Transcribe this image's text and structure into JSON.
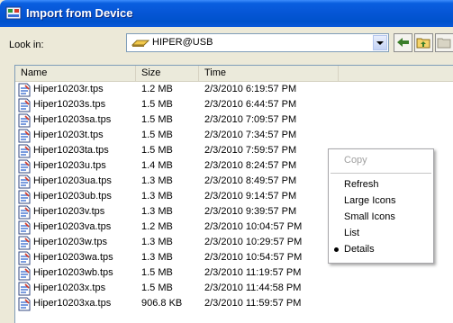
{
  "window": {
    "title": "Import from Device"
  },
  "toolbar": {
    "look_in_label": "Look in:",
    "location": "HIPER@USB"
  },
  "columns": {
    "name": "Name",
    "size": "Size",
    "time": "Time"
  },
  "files": [
    {
      "name": "Hiper10203r.tps",
      "size": "1.2 MB",
      "time": "2/3/2010 6:19:57 PM"
    },
    {
      "name": "Hiper10203s.tps",
      "size": "1.5 MB",
      "time": "2/3/2010 6:44:57 PM"
    },
    {
      "name": "Hiper10203sa.tps",
      "size": "1.5 MB",
      "time": "2/3/2010 7:09:57 PM"
    },
    {
      "name": "Hiper10203t.tps",
      "size": "1.5 MB",
      "time": "2/3/2010 7:34:57 PM"
    },
    {
      "name": "Hiper10203ta.tps",
      "size": "1.5 MB",
      "time": "2/3/2010 7:59:57 PM"
    },
    {
      "name": "Hiper10203u.tps",
      "size": "1.4 MB",
      "time": "2/3/2010 8:24:57 PM"
    },
    {
      "name": "Hiper10203ua.tps",
      "size": "1.3 MB",
      "time": "2/3/2010 8:49:57 PM"
    },
    {
      "name": "Hiper10203ub.tps",
      "size": "1.3 MB",
      "time": "2/3/2010 9:14:57 PM"
    },
    {
      "name": "Hiper10203v.tps",
      "size": "1.3 MB",
      "time": "2/3/2010 9:39:57 PM"
    },
    {
      "name": "Hiper10203va.tps",
      "size": "1.2 MB",
      "time": "2/3/2010 10:04:57 PM"
    },
    {
      "name": "Hiper10203w.tps",
      "size": "1.3 MB",
      "time": "2/3/2010 10:29:57 PM"
    },
    {
      "name": "Hiper10203wa.tps",
      "size": "1.3 MB",
      "time": "2/3/2010 10:54:57 PM"
    },
    {
      "name": "Hiper10203wb.tps",
      "size": "1.5 MB",
      "time": "2/3/2010 11:19:57 PM"
    },
    {
      "name": "Hiper10203x.tps",
      "size": "1.5 MB",
      "time": "2/3/2010 11:44:58 PM"
    },
    {
      "name": "Hiper10203xa.tps",
      "size": "906.8 KB",
      "time": "2/3/2010 11:59:57 PM"
    }
  ],
  "context_menu": {
    "items": [
      {
        "label": "Copy",
        "enabled": false,
        "checked": false
      },
      {
        "label": "Refresh",
        "enabled": true,
        "checked": false
      },
      {
        "label": "Large Icons",
        "enabled": true,
        "checked": false
      },
      {
        "label": "Small Icons",
        "enabled": true,
        "checked": false
      },
      {
        "label": "List",
        "enabled": true,
        "checked": false
      },
      {
        "label": "Details",
        "enabled": true,
        "checked": true
      }
    ]
  },
  "colors": {
    "titlebar": "#0a5fe0",
    "dialog_bg": "#ece9d8",
    "list_bg": "#ffffff"
  },
  "icons": {
    "title": "device-import-icon",
    "drive": "usb-drive-icon",
    "back": "back-arrow-icon",
    "up": "up-folder-icon",
    "file": "tps-file-icon"
  }
}
